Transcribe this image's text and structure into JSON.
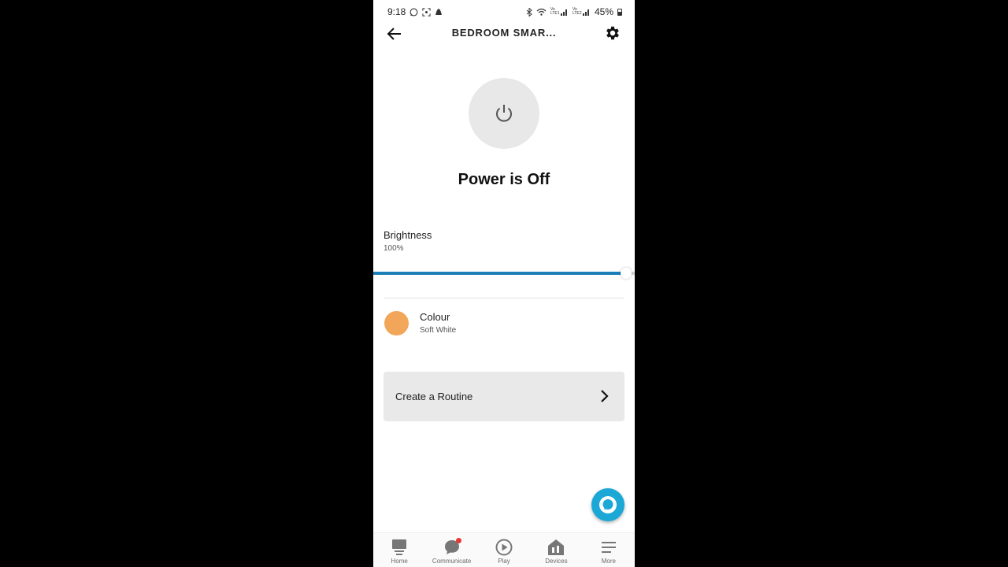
{
  "status_bar": {
    "time": "9:18",
    "network_label_1": "Vo LTE1",
    "network_label_2": "Vo LTE2",
    "battery": "45%"
  },
  "header": {
    "title": "BEDROOM SMAR..."
  },
  "power": {
    "status": "Power is Off"
  },
  "brightness": {
    "label": "Brightness",
    "value_text": "100%",
    "level": 1.0
  },
  "colour": {
    "label": "Colour",
    "value": "Soft White",
    "swatch_color": "#f2a65a"
  },
  "routine": {
    "label": "Create a Routine"
  },
  "bottom_nav": {
    "items": [
      {
        "label": "Home",
        "icon": "home-icon"
      },
      {
        "label": "Communicate",
        "icon": "chat-icon"
      },
      {
        "label": "Play",
        "icon": "play-icon"
      },
      {
        "label": "Devices",
        "icon": "devices-icon"
      },
      {
        "label": "More",
        "icon": "menu-icon"
      }
    ]
  },
  "colors": {
    "accent": "#1a7fb8",
    "alexa": "#1ca8d6"
  }
}
